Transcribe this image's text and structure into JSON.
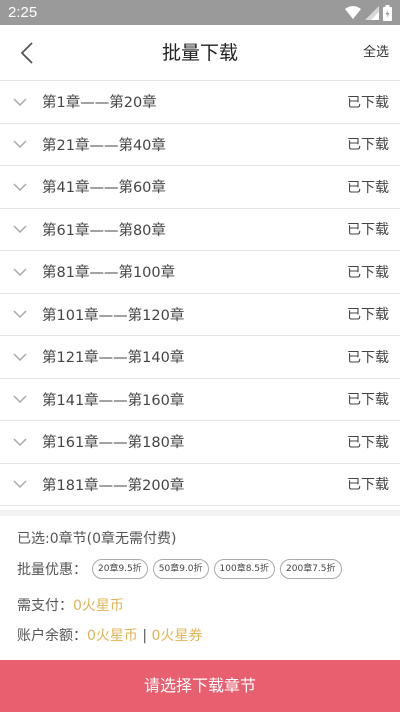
{
  "status_bar": {
    "time": "2:25"
  },
  "header": {
    "title": "批量下载",
    "select_all": "全选"
  },
  "chapters": [
    {
      "label": "第1章——第20章",
      "status": "已下载"
    },
    {
      "label": "第21章——第40章",
      "status": "已下载"
    },
    {
      "label": "第41章——第60章",
      "status": "已下载"
    },
    {
      "label": "第61章——第80章",
      "status": "已下载"
    },
    {
      "label": "第81章——第100章",
      "status": "已下载"
    },
    {
      "label": "第101章——第120章",
      "status": "已下载"
    },
    {
      "label": "第121章——第140章",
      "status": "已下载"
    },
    {
      "label": "第141章——第160章",
      "status": "已下载"
    },
    {
      "label": "第161章——第180章",
      "status": "已下载"
    },
    {
      "label": "第181章——第200章",
      "status": "已下载"
    }
  ],
  "summary": {
    "selected": "已选:0章节(0章无需付费)",
    "discount_label": "批量优惠：",
    "discounts": [
      "20章9.5折",
      "50章9.0折",
      "100章8.5折",
      "200章7.5折"
    ],
    "pay_label": "需支付：",
    "pay_value": "0火星币",
    "balance_label": "账户余额：",
    "balance_coins": "0火星币",
    "balance_sep": " | ",
    "balance_tickets": "0火星券"
  },
  "bottom_button": "请选择下载章节",
  "colors": {
    "accent": "#e8606f",
    "gold": "#e0b45a",
    "status_bar": "#9a9a9a"
  }
}
